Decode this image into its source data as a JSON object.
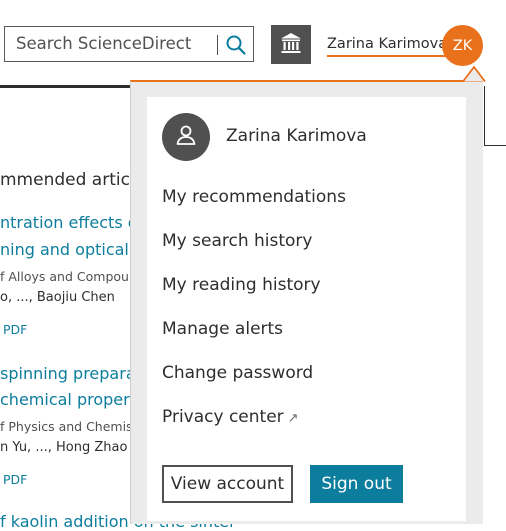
{
  "header": {
    "search_placeholder": "Search ScienceDirect",
    "user_name": "Zarina Karimova",
    "user_initials": "ZK"
  },
  "background": {
    "heading": "mmended articles",
    "articles": [
      {
        "title_line1": "ntration effects of flu",
        "title_line2": "ning and optical trans",
        "journal": "f Alloys and Compounds",
        "authors": "o, ..., Baojiu Chen",
        "pdf": "PDF"
      },
      {
        "title_line1": "spinning preparatio",
        "title_line2": "chemical properties",
        "journal": "f Physics and Chemistry o",
        "authors": "n Yu, ..., Hong Zhao",
        "pdf": "PDF"
      },
      {
        "title_line1": "f kaolin addition on the sinter"
      }
    ]
  },
  "popover": {
    "profile_name": "Zarina Karimova",
    "menu": [
      "My recommendations",
      "My search history",
      "My reading history",
      "Manage alerts",
      "Change password",
      "Privacy center"
    ],
    "view_account_label": "View account",
    "sign_out_label": "Sign out"
  },
  "colors": {
    "accent_orange": "#e9711c",
    "link_blue": "#0c7d9d",
    "dark_gray": "#505050"
  }
}
